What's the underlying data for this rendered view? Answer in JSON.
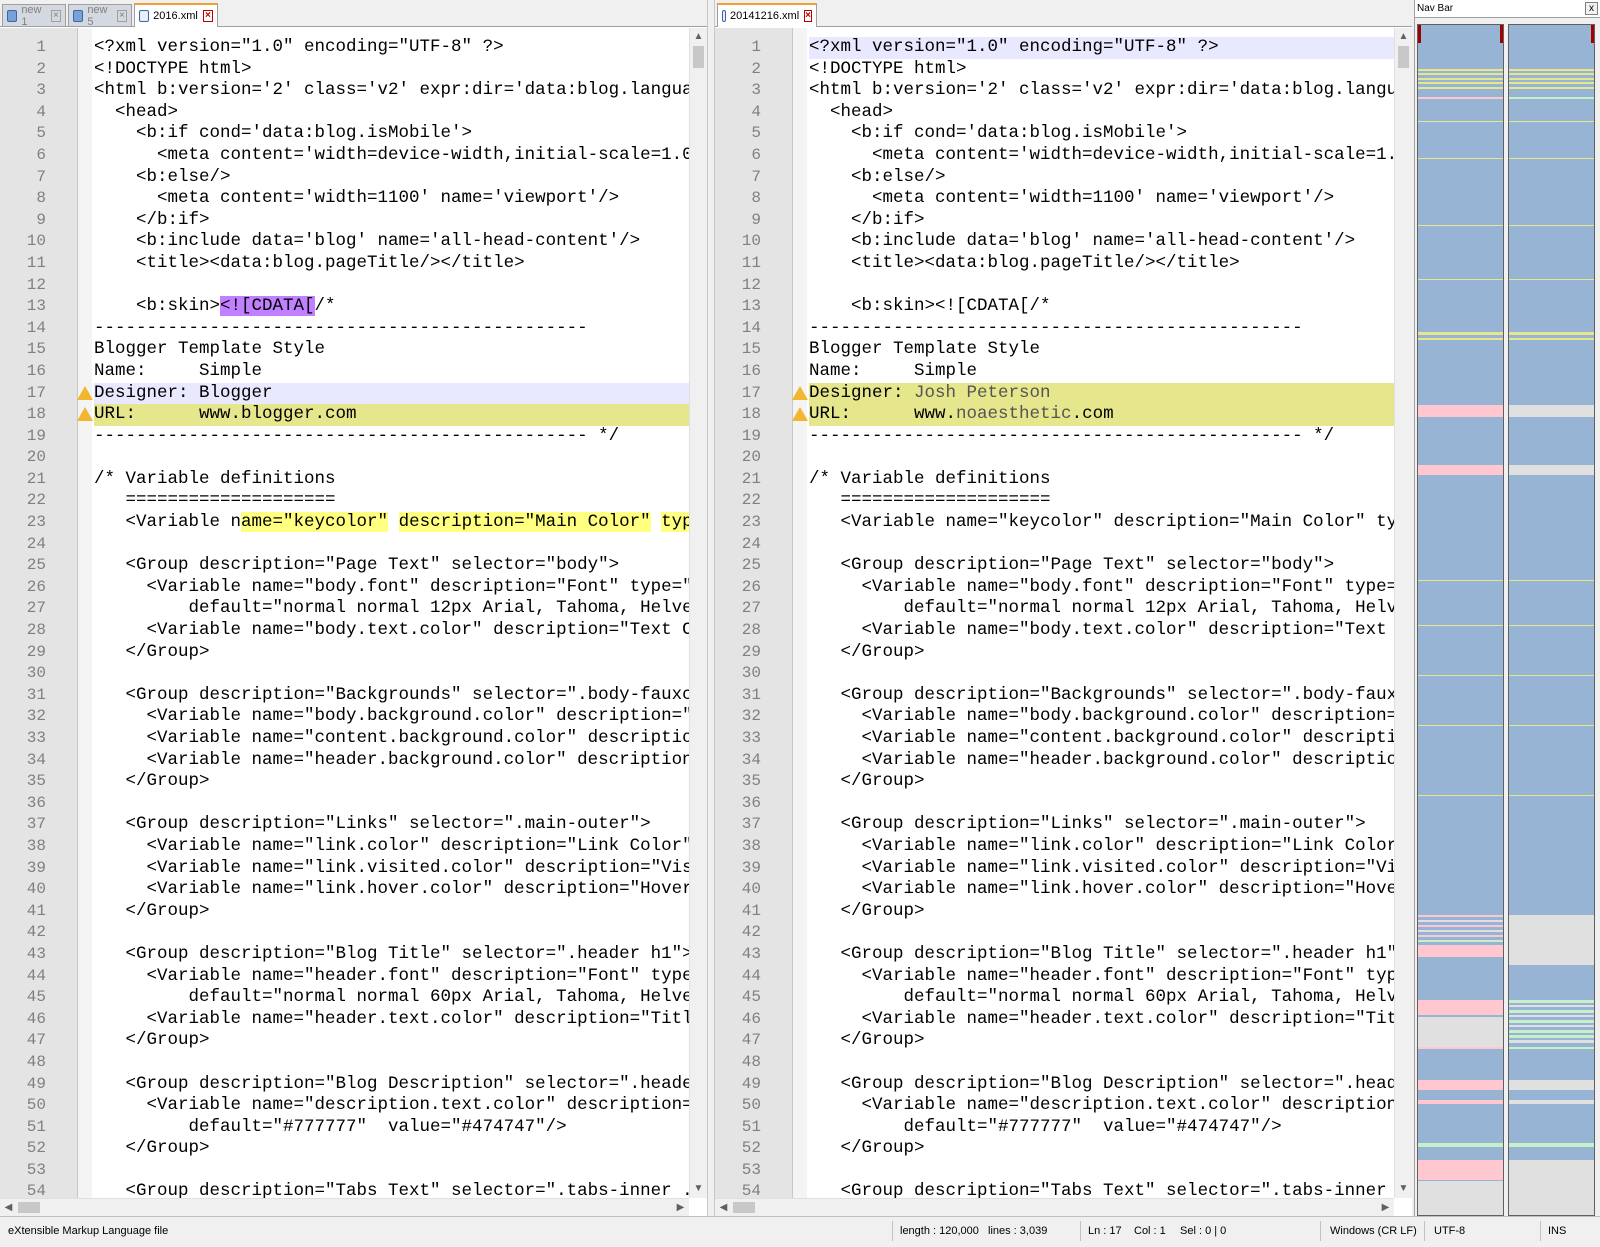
{
  "left_pane": {
    "tabs": [
      {
        "label": "new 1",
        "active": false
      },
      {
        "label": "new 5",
        "active": false
      },
      {
        "label": "2016.xml",
        "active": true
      }
    ],
    "lines": [
      {
        "n": "1",
        "text": "<?xml version=\"1.0\" encoding=\"UTF-8\" ?>"
      },
      {
        "n": "2",
        "text": "<!DOCTYPE html>"
      },
      {
        "n": "3",
        "text": "<html b:version='2' class='v2' expr:dir='data:blog.languag"
      },
      {
        "n": "4",
        "text": "  <head>"
      },
      {
        "n": "5",
        "text": "    <b:if cond='data:blog.isMobile'>"
      },
      {
        "n": "6",
        "text": "      <meta content='width=device-width,initial-scale=1.0,"
      },
      {
        "n": "7",
        "text": "    <b:else/>"
      },
      {
        "n": "8",
        "text": "      <meta content='width=1100' name='viewport'/>"
      },
      {
        "n": "9",
        "text": "    </b:if>"
      },
      {
        "n": "10",
        "text": "    <b:include data='blog' name='all-head-content'/>"
      },
      {
        "n": "11",
        "text": "    <title><data:blog.pageTitle/></title>"
      },
      {
        "n": "12",
        "text": ""
      },
      {
        "n": "13",
        "text": "    <b:skin>",
        "mark_purple": "<![CDATA[",
        "rest": "/*"
      },
      {
        "n": "14",
        "text": "-----------------------------------------------"
      },
      {
        "n": "15",
        "text": "Blogger Template Style"
      },
      {
        "n": "16",
        "text": "Name:     Simple"
      },
      {
        "n": "17",
        "text": "Designer: Blogger",
        "state": "blue",
        "warn": true
      },
      {
        "n": "18",
        "text": "URL:      www.blogger.com",
        "state": "yellow",
        "warn": true
      },
      {
        "n": "19",
        "text": "----------------------------------------------- */"
      },
      {
        "n": "20",
        "text": ""
      },
      {
        "n": "21",
        "text": "/* Variable definitions"
      },
      {
        "n": "22",
        "text": "   ===================="
      },
      {
        "n": "23",
        "text": "   <Variable n",
        "mark_yellow": "ame=\"keycolor\"",
        "gap": " ",
        "mark_yellow2": "description=\"Main Color\"",
        "gap2": " ",
        "mark_yellow3": "type"
      },
      {
        "n": "24",
        "text": ""
      },
      {
        "n": "25",
        "text": "   <Group description=\"Page Text\" selector=\"body\">"
      },
      {
        "n": "26",
        "text": "     <Variable name=\"body.font\" description=\"Font\" type=\"f"
      },
      {
        "n": "27",
        "text": "         default=\"normal normal 12px Arial, Tahoma, Helvet"
      },
      {
        "n": "28",
        "text": "     <Variable name=\"body.text.color\" description=\"Text Co"
      },
      {
        "n": "29",
        "text": "   </Group>"
      },
      {
        "n": "30",
        "text": ""
      },
      {
        "n": "31",
        "text": "   <Group description=\"Backgrounds\" selector=\".body-fauxco"
      },
      {
        "n": "32",
        "text": "     <Variable name=\"body.background.color\" description=\"C"
      },
      {
        "n": "33",
        "text": "     <Variable name=\"content.background.color\" description"
      },
      {
        "n": "34",
        "text": "     <Variable name=\"header.background.color\" description="
      },
      {
        "n": "35",
        "text": "   </Group>"
      },
      {
        "n": "36",
        "text": ""
      },
      {
        "n": "37",
        "text": "   <Group description=\"Links\" selector=\".main-outer\">"
      },
      {
        "n": "38",
        "text": "     <Variable name=\"link.color\" description=\"Link Color\""
      },
      {
        "n": "39",
        "text": "     <Variable name=\"link.visited.color\" description=\"Visi"
      },
      {
        "n": "40",
        "text": "     <Variable name=\"link.hover.color\" description=\"Hover"
      },
      {
        "n": "41",
        "text": "   </Group>"
      },
      {
        "n": "42",
        "text": ""
      },
      {
        "n": "43",
        "text": "   <Group description=\"Blog Title\" selector=\".header h1\">"
      },
      {
        "n": "44",
        "text": "     <Variable name=\"header.font\" description=\"Font\" type="
      },
      {
        "n": "45",
        "text": "         default=\"normal normal 60px Arial, Tahoma, Helvet"
      },
      {
        "n": "46",
        "text": "     <Variable name=\"header.text.color\" description=\"Title"
      },
      {
        "n": "47",
        "text": "   </Group>"
      },
      {
        "n": "48",
        "text": ""
      },
      {
        "n": "49",
        "text": "   <Group description=\"Blog Description\" selector=\".header"
      },
      {
        "n": "50",
        "text": "     <Variable name=\"description.text.color\" description=\""
      },
      {
        "n": "51",
        "text": "         default=\"#777777\"  value=\"#474747\"/>"
      },
      {
        "n": "52",
        "text": "   </Group>"
      },
      {
        "n": "53",
        "text": ""
      },
      {
        "n": "54",
        "text": "   <Group description=\"Tabs Text\" selector=\".tabs-inner .w"
      }
    ]
  },
  "right_pane": {
    "tabs": [
      {
        "label": "20141216.xml",
        "active": true
      }
    ],
    "lines": [
      {
        "n": "1",
        "text": "<?xml version=\"1.0\" encoding=\"UTF-8\" ?>",
        "state": "blue"
      },
      {
        "n": "2",
        "text": "<!DOCTYPE html>"
      },
      {
        "n": "3",
        "text": "<html b:version='2' class='v2' expr:dir='data:blog.langua"
      },
      {
        "n": "4",
        "text": "  <head>"
      },
      {
        "n": "5",
        "text": "    <b:if cond='data:blog.isMobile'>"
      },
      {
        "n": "6",
        "text": "      <meta content='width=device-width,initial-scale=1.0"
      },
      {
        "n": "7",
        "text": "    <b:else/>"
      },
      {
        "n": "8",
        "text": "      <meta content='width=1100' name='viewport'/>"
      },
      {
        "n": "9",
        "text": "    </b:if>"
      },
      {
        "n": "10",
        "text": "    <b:include data='blog' name='all-head-content'/>"
      },
      {
        "n": "11",
        "text": "    <title><data:blog.pageTitle/></title>"
      },
      {
        "n": "12",
        "text": ""
      },
      {
        "n": "13",
        "text": "    <b:skin><![CDATA[/*"
      },
      {
        "n": "14",
        "text": "-----------------------------------------------"
      },
      {
        "n": "15",
        "text": "Blogger Template Style"
      },
      {
        "n": "16",
        "text": "Name:     Simple"
      },
      {
        "n": "17",
        "text": "Designer: ",
        "changed": "Josh Peterson",
        "state": "yellow",
        "warn": true
      },
      {
        "n": "18",
        "text": "URL:      www.",
        "changed": "noaesthetic",
        "rest": ".com",
        "state": "yellow",
        "warn": true
      },
      {
        "n": "19",
        "text": "----------------------------------------------- */"
      },
      {
        "n": "20",
        "text": ""
      },
      {
        "n": "21",
        "text": "/* Variable definitions"
      },
      {
        "n": "22",
        "text": "   ===================="
      },
      {
        "n": "23",
        "text": "   <Variable name=\"keycolor\" description=\"Main Color\" typ"
      },
      {
        "n": "24",
        "text": ""
      },
      {
        "n": "25",
        "text": "   <Group description=\"Page Text\" selector=\"body\">"
      },
      {
        "n": "26",
        "text": "     <Variable name=\"body.font\" description=\"Font\" type=\""
      },
      {
        "n": "27",
        "text": "         default=\"normal normal 12px Arial, Tahoma, Helve"
      },
      {
        "n": "28",
        "text": "     <Variable name=\"body.text.color\" description=\"Text C"
      },
      {
        "n": "29",
        "text": "   </Group>"
      },
      {
        "n": "30",
        "text": ""
      },
      {
        "n": "31",
        "text": "   <Group description=\"Backgrounds\" selector=\".body-fauxc"
      },
      {
        "n": "32",
        "text": "     <Variable name=\"body.background.color\" description=\""
      },
      {
        "n": "33",
        "text": "     <Variable name=\"content.background.color\" descriptio"
      },
      {
        "n": "34",
        "text": "     <Variable name=\"header.background.color\" description"
      },
      {
        "n": "35",
        "text": "   </Group>"
      },
      {
        "n": "36",
        "text": ""
      },
      {
        "n": "37",
        "text": "   <Group description=\"Links\" selector=\".main-outer\">"
      },
      {
        "n": "38",
        "text": "     <Variable name=\"link.color\" description=\"Link Color\""
      },
      {
        "n": "39",
        "text": "     <Variable name=\"link.visited.color\" description=\"Vis"
      },
      {
        "n": "40",
        "text": "     <Variable name=\"link.hover.color\" description=\"Hover"
      },
      {
        "n": "41",
        "text": "   </Group>"
      },
      {
        "n": "42",
        "text": ""
      },
      {
        "n": "43",
        "text": "   <Group description=\"Blog Title\" selector=\".header h1\">"
      },
      {
        "n": "44",
        "text": "     <Variable name=\"header.font\" description=\"Font\" type"
      },
      {
        "n": "45",
        "text": "         default=\"normal normal 60px Arial, Tahoma, Helve"
      },
      {
        "n": "46",
        "text": "     <Variable name=\"header.text.color\" description=\"Titl"
      },
      {
        "n": "47",
        "text": "   </Group>"
      },
      {
        "n": "48",
        "text": ""
      },
      {
        "n": "49",
        "text": "   <Group description=\"Blog Description\" selector=\".heade"
      },
      {
        "n": "50",
        "text": "     <Variable name=\"description.text.color\" description="
      },
      {
        "n": "51",
        "text": "         default=\"#777777\"  value=\"#474747\"/>"
      },
      {
        "n": "52",
        "text": "   </Group>"
      },
      {
        "n": "53",
        "text": ""
      },
      {
        "n": "54",
        "text": "   <Group description=\"Tabs Text\" selector=\".tabs-inner ."
      }
    ]
  },
  "nav_bar": {
    "title": "Nav Bar",
    "close": "x",
    "colors": {
      "base": "#98b4d4",
      "changed": "#e6e68c",
      "removed": "#ffc8d0",
      "added": "#c8f0c8",
      "blank": "#e0e0e0"
    }
  },
  "status_bar": {
    "file_type": "eXtensible Markup Language file",
    "length": "length : 120,000",
    "lines": "lines : 3,039",
    "ln": "Ln : 17",
    "col": "Col : 1",
    "sel": "Sel : 0 | 0",
    "eol": "Windows (CR LF)",
    "encoding": "UTF-8",
    "mode": "INS"
  },
  "theme": {
    "warning_icon": "warning-triangle-icon",
    "close_icon": "close-icon",
    "file_icon": "file-icon"
  }
}
